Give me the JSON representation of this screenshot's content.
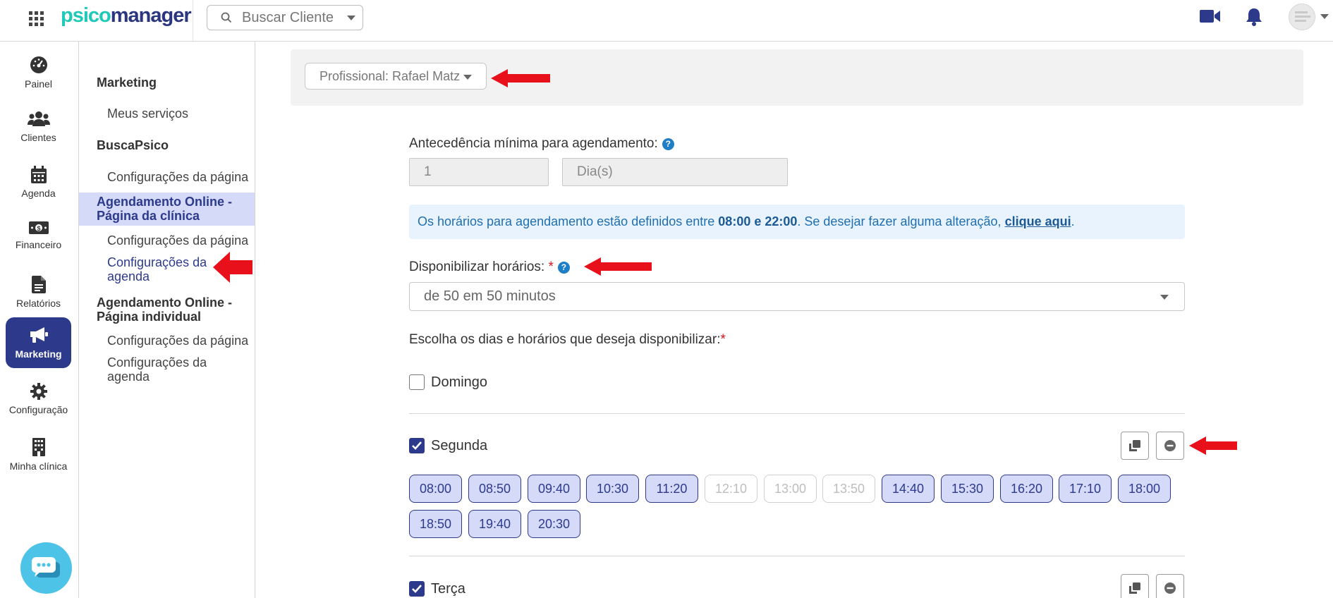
{
  "brand": {
    "logo_part1": "psico",
    "logo_part2": "manager"
  },
  "header": {
    "search_placeholder": "Buscar Cliente"
  },
  "leftnav": [
    {
      "key": "painel",
      "label": "Painel",
      "icon": "dashboard-gauge-icon"
    },
    {
      "key": "clientes",
      "label": "Clientes",
      "icon": "users-icon"
    },
    {
      "key": "agenda",
      "label": "Agenda",
      "icon": "calendar-icon"
    },
    {
      "key": "financeiro",
      "label": "Financeiro",
      "icon": "money-bill-icon"
    },
    {
      "key": "relatorios",
      "label": "Relatórios",
      "icon": "document-icon"
    },
    {
      "key": "marketing",
      "label": "Marketing",
      "icon": "megaphone-icon",
      "active": true
    },
    {
      "key": "configuracao",
      "label": "Configuração",
      "icon": "gear-icon"
    },
    {
      "key": "minha-clinica",
      "label": "Minha clínica",
      "icon": "building-icon"
    }
  ],
  "submenu": {
    "marketing": "Marketing",
    "meus_servicos": "Meus serviços",
    "buscapsico": "BuscaPsico",
    "buscapsico_config": "Configurações da página",
    "agend_clinica_line1": "Agendamento Online -",
    "agend_clinica_line2": "Página da clínica",
    "clinica_config_pagina": "Configurações da página",
    "clinica_config_agenda_line1": "Configurações da",
    "clinica_config_agenda_line2": "agenda",
    "agend_individual_line1": "Agendamento Online -",
    "agend_individual_line2": "Página individual",
    "individual_config_pagina": "Configurações da página",
    "individual_config_agenda_line1": "Configurações da",
    "individual_config_agenda_line2": "agenda"
  },
  "main": {
    "profissional_select": "Profissional: Rafael Matz",
    "antecedencia_label": "Antecedência mínima para agendamento:",
    "antecedencia_value": "1",
    "antecedencia_unit": "Dia(s)",
    "info_text_1": "Os horários para agendamento estão definidos entre",
    "info_hours": "08:00 e 22:00",
    "info_text_2": ". Se desejar fazer alguma alteração,",
    "info_link": "clique aqui",
    "info_text_3": ".",
    "disponibilizar_label": "Disponibilizar horários:",
    "required_mark": "*",
    "help_mark": "?",
    "interval_value": "de 50 em 50 minutos",
    "escolha_label": "Escolha os dias e horários que deseja disponibilizar:",
    "days": [
      {
        "name": "Domingo",
        "checked": false
      },
      {
        "name": "Segunda",
        "checked": true,
        "slots": [
          {
            "time": "08:00",
            "on": true
          },
          {
            "time": "08:50",
            "on": true
          },
          {
            "time": "09:40",
            "on": true
          },
          {
            "time": "10:30",
            "on": true
          },
          {
            "time": "11:20",
            "on": true
          },
          {
            "time": "12:10",
            "on": false
          },
          {
            "time": "13:00",
            "on": false
          },
          {
            "time": "13:50",
            "on": false
          },
          {
            "time": "14:40",
            "on": true
          },
          {
            "time": "15:30",
            "on": true
          },
          {
            "time": "16:20",
            "on": true
          },
          {
            "time": "17:10",
            "on": true
          },
          {
            "time": "18:00",
            "on": true
          },
          {
            "time": "18:50",
            "on": true
          },
          {
            "time": "19:40",
            "on": true
          },
          {
            "time": "20:30",
            "on": true
          }
        ]
      },
      {
        "name": "Terça",
        "checked": true
      }
    ]
  },
  "colors": {
    "primary": "#2d3a8c",
    "slot_bg": "#d4daf8",
    "info_bg": "#e8f3fd",
    "annotation_arrow": "#e8101a",
    "logo_teal": "#1ec9b8"
  }
}
